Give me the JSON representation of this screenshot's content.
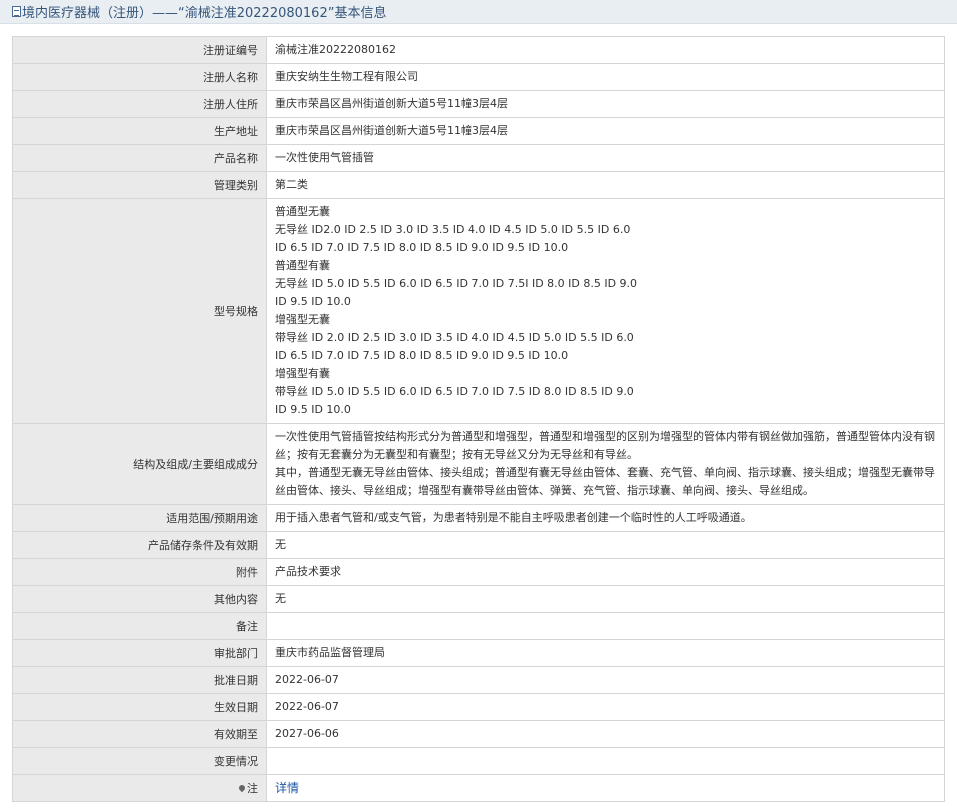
{
  "page": {
    "title": "境内医疗器械（注册）——“渝械注准20222080162”基本信息"
  },
  "rows": {
    "reg_no": {
      "label": "注册证编号",
      "value": "渝械注准20222080162"
    },
    "registrant": {
      "label": "注册人名称",
      "value": "重庆安纳生生物工程有限公司"
    },
    "registrant_address": {
      "label": "注册人住所",
      "value": "重庆市荣昌区昌州街道创新大道5号11幢3层4层"
    },
    "production_address": {
      "label": "生产地址",
      "value": "重庆市荣昌区昌州街道创新大道5号11幢3层4层"
    },
    "product_name": {
      "label": "产品名称",
      "value": "一次性使用气管插管"
    },
    "category": {
      "label": "管理类别",
      "value": "第二类"
    },
    "models": {
      "label": "型号规格",
      "lines": [
        "普通型无囊",
        "无导丝 ID2.0 ID 2.5 ID 3.0 ID 3.5 ID 4.0 ID 4.5 ID 5.0 ID 5.5 ID 6.0",
        "ID 6.5 ID 7.0 ID 7.5 ID 8.0 ID 8.5 ID 9.0 ID 9.5 ID 10.0",
        "普通型有囊",
        "无导丝 ID 5.0 ID 5.5 ID 6.0 ID 6.5 ID 7.0 ID 7.5I ID 8.0 ID 8.5 ID 9.0",
        "ID 9.5 ID 10.0",
        "增强型无囊",
        "带导丝 ID 2.0 ID 2.5 ID 3.0 ID 3.5 ID 4.0 ID 4.5 ID 5.0 ID 5.5 ID 6.0",
        "ID 6.5 ID 7.0 ID 7.5 ID 8.0 ID 8.5 ID 9.0 ID 9.5 ID 10.0",
        "增强型有囊",
        "带导丝 ID 5.0 ID 5.5 ID 6.0 ID 6.5 ID 7.0 ID 7.5 ID 8.0 ID 8.5 ID 9.0",
        "ID 9.5 ID 10.0"
      ]
    },
    "structure": {
      "label": "结构及组成/主要组成成分",
      "paragraphs": [
        "一次性使用气管插管按结构形式分为普通型和增强型，普通型和增强型的区别为增强型的管体内带有钢丝做加强筋，普通型管体内没有钢丝；按有无套囊分为无囊型和有囊型；按有无导丝又分为无导丝和有导丝。",
        "其中，普通型无囊无导丝由管体、接头组成；普通型有囊无导丝由管体、套囊、充气管、单向阀、指示球囊、接头组成；增强型无囊带导丝由管体、接头、导丝组成；增强型有囊带导丝由管体、弹簧、充气管、指示球囊、单向阀、接头、导丝组成。"
      ]
    },
    "scope": {
      "label": "适用范围/预期用途",
      "value": "用于插入患者气管和/或支气管，为患者特别是不能自主呼吸患者创建一个临时性的人工呼吸通道。"
    },
    "storage": {
      "label": "产品储存条件及有效期",
      "value": "无"
    },
    "attachment": {
      "label": "附件",
      "value": "产品技术要求"
    },
    "other": {
      "label": "其他内容",
      "value": "无"
    },
    "remark": {
      "label": "备注",
      "value": ""
    },
    "approval_dept": {
      "label": "审批部门",
      "value": "重庆市药品监督管理局"
    },
    "approval_date": {
      "label": "批准日期",
      "value": "2022-06-07"
    },
    "effective_date": {
      "label": "生效日期",
      "value": "2022-06-07"
    },
    "valid_until": {
      "label": "有效期至",
      "value": "2027-06-06"
    },
    "changes": {
      "label": "变更情况",
      "value": ""
    },
    "note": {
      "label": "注",
      "link_text": "详情",
      "icon": "map-pin-icon"
    }
  },
  "colors": {
    "label_bg": "#eaeaea",
    "border": "#d5d5d5",
    "title_bar_bg": "#e9eef3",
    "title_text": "#35557a",
    "link": "#1e57a5"
  }
}
